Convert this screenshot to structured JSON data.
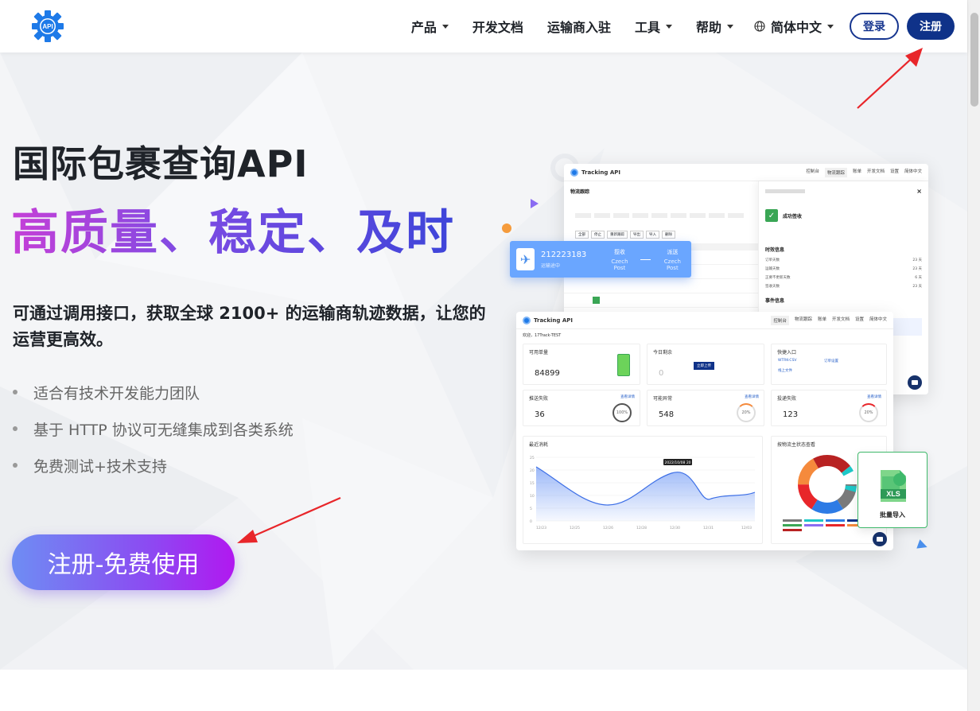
{
  "header": {
    "logo_text": "API",
    "nav": [
      {
        "label": "产品",
        "has_dropdown": true
      },
      {
        "label": "开发文档",
        "has_dropdown": false
      },
      {
        "label": "运输商入驻",
        "has_dropdown": false
      },
      {
        "label": "工具",
        "has_dropdown": true
      },
      {
        "label": "帮助",
        "has_dropdown": true
      }
    ],
    "language": "简体中文",
    "login_label": "登录",
    "register_label": "注册"
  },
  "hero": {
    "title": "国际包裹查询API",
    "slogan": "高质量、稳定、及时",
    "description": "可通过调用接口，获取全球 2100+ 的运输商轨迹数据，让您的运营更高效。",
    "features": [
      "适合有技术开发能力团队",
      "基于 HTTP 协议可无缝集成到各类系统",
      "免费测试+技术支持"
    ],
    "cta_label": "注册-免费使用"
  },
  "mockup": {
    "brand": "Tracking API",
    "back_nav": [
      "控制台",
      "物流跟踪",
      "账单",
      "开发文档",
      "设置",
      "简体中文"
    ],
    "back_title": "物流跟踪",
    "back_filters": [
      "全部",
      "停止",
      "重新跟踪",
      "导出",
      "导入",
      "删除"
    ],
    "panel_status": "成功签收",
    "panel_sections": [
      "时效信息",
      "事件信息"
    ],
    "panel_rows": [
      {
        "label": "订单天数",
        "value": "23 天"
      },
      {
        "label": "运输天数",
        "value": "23 天"
      },
      {
        "label": "正要不更新天数",
        "value": "6 天"
      },
      {
        "label": "签收天数",
        "value": "23 天"
      }
    ],
    "tracking_number": "212223183",
    "tracking_status": "运输途中",
    "tracking_from_label": "揽收",
    "tracking_from": "Czech Post",
    "tracking_to_label": "派送",
    "tracking_to": "Czech Post",
    "front_nav": [
      "控制台",
      "物流跟踪",
      "账单",
      "开发文档",
      "设置",
      "简体中文"
    ],
    "welcome": "欢迎，17Track-TEST",
    "stats": [
      {
        "label": "可用单量",
        "value": "84899"
      },
      {
        "label": "今日剩余",
        "value": "0",
        "button": "立即上传"
      },
      {
        "label": "快捷入口",
        "links": [
          "WTRK-CSV",
          "订单设置",
          "线上文件"
        ]
      },
      {
        "label": "推送失败",
        "value": "36",
        "ring": "100%",
        "link": "查看详情"
      },
      {
        "label": "可能异常",
        "value": "548",
        "ring": "20%",
        "link": "查看详情"
      },
      {
        "label": "投递失败",
        "value": "123",
        "ring": "20%",
        "link": "查看详情"
      }
    ],
    "chart_title": "最近消耗",
    "chart_tooltip": "2022/10/08 20",
    "chart_x_ticks": [
      "12/23",
      "12/25",
      "12/26",
      "12/28",
      "12/30",
      "12/31",
      "12/03"
    ],
    "chart_y_ticks": [
      "25",
      "20",
      "15",
      "10",
      "5",
      "0"
    ],
    "donut_title": "按物流主状态查看",
    "xls_label": "批量导入",
    "xls_text": "XLS"
  },
  "colors": {
    "brand_blue": "#0f3289",
    "slogan_gradient_start": "#c53fd7",
    "slogan_gradient_end": "#3d45d9",
    "cta_gradient_start": "#6e8df3",
    "cta_gradient_end": "#b118f0",
    "annotation_arrow": "#e8262a"
  },
  "icons": [
    "api-gear-logo-icon",
    "caret-down-icon",
    "globe-icon",
    "airplane-icon",
    "chat-icon",
    "xls-file-icon"
  ]
}
